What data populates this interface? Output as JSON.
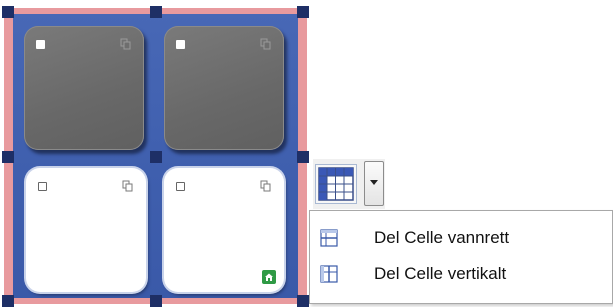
{
  "grid": {
    "cells": [
      {
        "name": "cell-top-left",
        "style": "dark"
      },
      {
        "name": "cell-top-right",
        "style": "dark"
      },
      {
        "name": "cell-bottom-left",
        "style": "light"
      },
      {
        "name": "cell-bottom-right",
        "style": "light",
        "badge": "home-icon"
      }
    ],
    "colors": {
      "panel": "#4868b6",
      "border": "#e89a9e",
      "handle": "#1e2f66",
      "dark_cell": "#6e6e6e",
      "home_badge": "#2f9a45"
    }
  },
  "toolbar": {
    "table_icon": "table-grid-icon",
    "dropdown_icon": "chevron-down-icon"
  },
  "menu": {
    "items": [
      {
        "label": "Del Celle vannrett",
        "icon": "split-horizontal-icon"
      },
      {
        "label": "Del Celle vertikalt",
        "icon": "split-vertical-icon"
      }
    ]
  }
}
